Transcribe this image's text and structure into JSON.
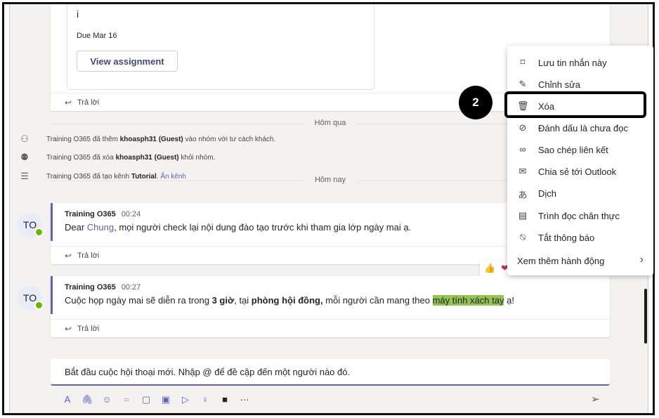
{
  "assignment": {
    "title": "i",
    "due": "Due Mar 16",
    "view_button": "View assignment",
    "reply": "Trả lời"
  },
  "dividers": {
    "yesterday": "Hôm qua",
    "today": "Hôm nay"
  },
  "system_events": [
    {
      "icon": "add-user-icon",
      "actor": "Training O365",
      "pre": " đã thêm ",
      "target": "khoasph31 (Guest)",
      "post": " vào nhóm với tư cách khách."
    },
    {
      "icon": "remove-user-icon",
      "actor": "Training O365",
      "pre": " đã xóa ",
      "target": "khoasph31 (Guest)",
      "post": " khỏi nhóm."
    },
    {
      "icon": "channel-icon",
      "actor": "Training O365",
      "pre": " đã tạo kênh ",
      "target": "Tutorial",
      "post": ". ",
      "link": "Ẩn kênh"
    }
  ],
  "messages": [
    {
      "avatar": "TO",
      "author": "Training O365",
      "time": "00:24",
      "text_pre": "Dear ",
      "mention": "Chung",
      "text_post": ", mọi người check lại nội dung đào tạo trước khi tham gia lớp ngày mai ạ.",
      "reply": "Trả lời"
    },
    {
      "avatar": "TO",
      "author": "Training O365",
      "time": "00:27",
      "text_1": "Cuộc họp ngày mai sẽ diễn ra trong ",
      "bold_1": "3 giờ",
      "text_2": ", tại ",
      "bold_2": "phòng hội đồng,",
      "text_3": " mỗi người cần mang theo ",
      "highlight": "máy tính xách tay",
      "text_4": " ạ!",
      "reply": "Trả lời"
    }
  ],
  "reactions": [
    "👍",
    "❤"
  ],
  "compose": {
    "placeholder": "Bắt đầu cuộc hội thoại mới. Nhập @ để đề cập đến một người nào đó."
  },
  "toolbar_icons": [
    "format-icon",
    "attach-icon",
    "emoji-icon",
    "gif-icon",
    "sticker-icon",
    "meet-now-icon",
    "stream-icon",
    "praise-icon",
    "youtube-icon",
    "more-options-icon",
    "send-icon"
  ],
  "context_menu": {
    "items": [
      {
        "icon": "bookmark-icon",
        "label": "Lưu tin nhắn này"
      },
      {
        "icon": "edit-icon",
        "label": "Chỉnh sửa"
      },
      {
        "icon": "delete-icon",
        "label": "Xóa"
      },
      {
        "icon": "mark-unread-icon",
        "label": "Đánh dấu là chưa đọc"
      },
      {
        "icon": "copy-link-icon",
        "label": "Sao chép liên kết"
      },
      {
        "icon": "share-outlook-icon",
        "label": "Chia sẻ tới Outlook"
      },
      {
        "icon": "translate-icon",
        "label": "Dịch"
      },
      {
        "icon": "immersive-reader-icon",
        "label": "Trình đọc chân thực"
      },
      {
        "icon": "notifications-off-icon",
        "label": "Tắt thông báo"
      }
    ],
    "more": "Xem thêm hành động"
  },
  "step_badge": "2"
}
